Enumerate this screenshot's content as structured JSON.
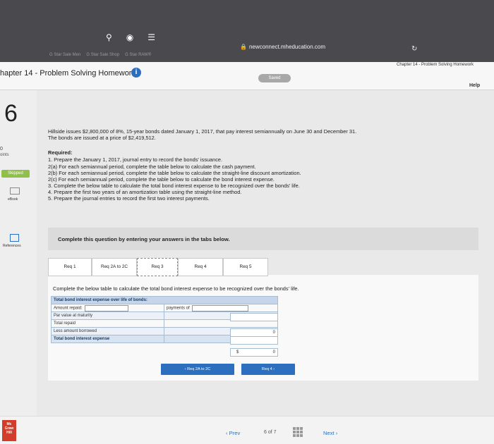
{
  "browser": {
    "url": "newconnect.mheducation.com",
    "bookmarks": [
      "G Star Sale Men",
      "G Star Sale Shop",
      "G Star RAW®"
    ],
    "right_tab_title": "Chapter 14 - Problem Solving Homework"
  },
  "header": {
    "assignment_title": "hapter 14 - Problem Solving Homework",
    "saved_label": "Saved",
    "help_label": "Help"
  },
  "sidebar": {
    "question_number": "6",
    "points_value": "0",
    "points_label": "oints",
    "skipped_label": "Skipped",
    "ebook_label": "eBook",
    "references_label": "References"
  },
  "problem": {
    "intro_1": "Hillside issues $2,800,000 of 8%, 15-year bonds dated January 1, 2017, that pay interest semiannually on June 30 and December 31.",
    "intro_2": "The bonds are issued at a price of $2,419,512.",
    "required_label": "Required:",
    "req_items": [
      "1. Prepare the January 1, 2017, journal entry to record the bonds' issuance.",
      "2(a) For each semiannual period, complete the table below to calculate the cash payment.",
      "2(b) For each semiannual period, complete the table below to calculate the straight-line discount amortization.",
      "2(c) For each semiannual period, complete the table below to calculate the bond interest expense.",
      "3. Complete the below table to calculate the total bond interest expense to be recognized over the bonds' life.",
      "4. Prepare the first two years of an amortization table using the straight-line method.",
      "5. Prepare the journal entries to record the first two interest payments."
    ]
  },
  "instruction": "Complete this question by entering your answers in the tabs below.",
  "tabs": [
    "Req 1",
    "Req 2A to 2C",
    "Req 3",
    "Req 4",
    "Req 5"
  ],
  "tab_prompt": "Complete the below table to calculate the total bond interest expense to be recognized over the bonds' life.",
  "table": {
    "header": "Total bond interest expense over life of bonds:",
    "rows": {
      "amount_repaid": "Amount repaid:",
      "payments_of": "payments of",
      "par_value": "Par value at maturity",
      "total_repaid": "Total repaid",
      "less_borrowed": "Less amount borrowed",
      "total_expense": "Total bond interest expense"
    },
    "values": {
      "total_repaid": "0",
      "currency": "$",
      "total_expense": "0"
    }
  },
  "nav": {
    "prev_tab": "Req 2A to 2C",
    "next_tab": "Req 4"
  },
  "footer": {
    "logo_text": "Mc Graw Hill",
    "prev_label": "Prev",
    "page_current": "6",
    "page_of": "of",
    "page_total": "7",
    "next_label": "Next"
  }
}
